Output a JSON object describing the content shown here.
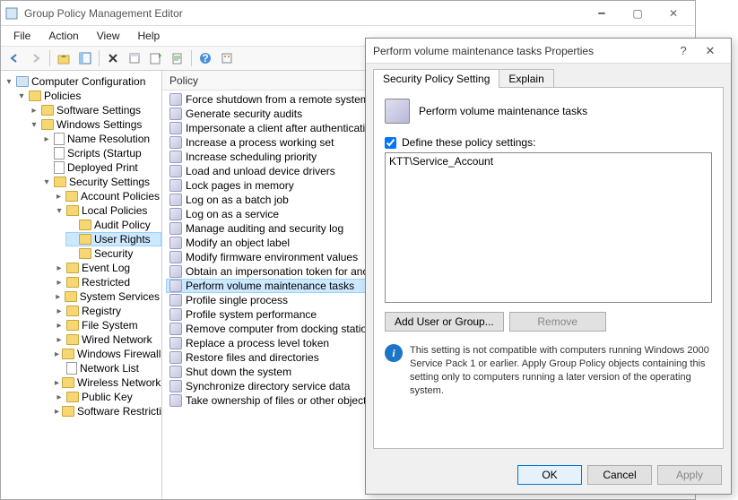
{
  "window": {
    "title": "Group Policy Management Editor"
  },
  "menu": [
    "File",
    "Action",
    "View",
    "Help"
  ],
  "tree": {
    "root": "Computer Configuration",
    "items": [
      "Policies",
      "Software Settings",
      "Windows Settings",
      "Name Resolution",
      "Scripts (Startup",
      "Deployed Print",
      "Security Settings",
      "Account Policies",
      "Local Policies",
      "Audit Policy",
      "User Rights",
      "Security",
      "Event Log",
      "Restricted",
      "System Services",
      "Registry",
      "File System",
      "Wired Network",
      "Windows Firewall",
      "Network List",
      "Wireless Network",
      "Public Key",
      "Software Restriction"
    ]
  },
  "policy_list": {
    "header": "Policy",
    "items": [
      "Force shutdown from a remote system",
      "Generate security audits",
      "Impersonate a client after authentication",
      "Increase a process working set",
      "Increase scheduling priority",
      "Load and unload device drivers",
      "Lock pages in memory",
      "Log on as a batch job",
      "Log on as a service",
      "Manage auditing and security log",
      "Modify an object label",
      "Modify firmware environment values",
      "Obtain an impersonation token for another",
      "Perform volume maintenance tasks",
      "Profile single process",
      "Profile system performance",
      "Remove computer from docking station",
      "Replace a process level token",
      "Restore files and directories",
      "Shut down the system",
      "Synchronize directory service data",
      "Take ownership of files or other objects"
    ],
    "selected_index": 13
  },
  "dialog": {
    "title": "Perform volume maintenance tasks Properties",
    "tabs": [
      "Security Policy Setting",
      "Explain"
    ],
    "policy_name": "Perform volume maintenance tasks",
    "checkbox_label": "Define these policy settings:",
    "checkbox_checked": true,
    "principals": [
      "KTT\\Service_Account"
    ],
    "add_button": "Add User or Group...",
    "remove_button": "Remove",
    "info_text": "This setting is not compatible with computers running Windows 2000 Service Pack 1 or earlier.  Apply Group Policy objects containing this setting only to computers running a later version of the operating system.",
    "ok": "OK",
    "cancel": "Cancel",
    "apply": "Apply"
  }
}
